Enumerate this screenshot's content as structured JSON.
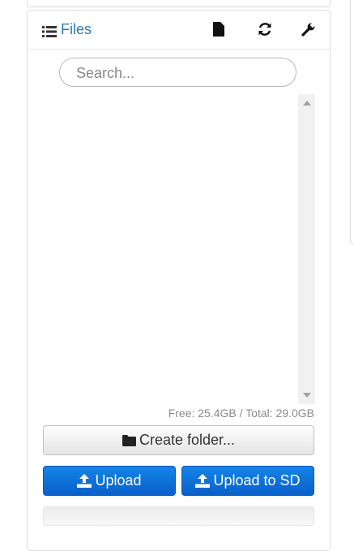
{
  "header": {
    "title": "Files",
    "icons": {
      "list": "list-icon",
      "new_file": "file-icon",
      "refresh": "refresh-icon",
      "settings": "wrench-icon"
    }
  },
  "search": {
    "placeholder": "Search...",
    "value": ""
  },
  "file_list": {
    "items": []
  },
  "disk": {
    "info": "Free: 25.4GB / Total: 29.0GB"
  },
  "actions": {
    "create_folder_label": "Create folder...",
    "upload_label": "Upload",
    "upload_sd_label": "Upload to SD"
  },
  "progress": {
    "percent": 0
  },
  "colors": {
    "accent": "#2a7ab8",
    "primary_button": "#0d6fd8",
    "muted_text": "#8a8a8a"
  }
}
